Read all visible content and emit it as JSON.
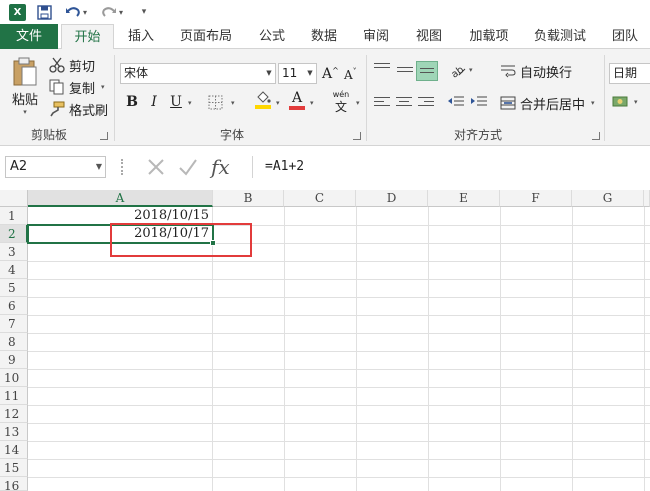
{
  "qat": {
    "logo_text": "X",
    "save_icon": "save-icon",
    "undo_icon": "undo-icon",
    "redo_icon": "redo-icon",
    "customize_icon": "customize-icon"
  },
  "tabs": [
    "文件",
    "开始",
    "插入",
    "页面布局",
    "公式",
    "数据",
    "审阅",
    "视图",
    "加载项",
    "负载测试",
    "团队"
  ],
  "active_tab": "开始",
  "ribbon": {
    "clipboard": {
      "paste_label": "粘贴",
      "cut_label": "剪切",
      "copy_label": "复制",
      "format_painter_label": "格式刷",
      "group_label": "剪贴板"
    },
    "font": {
      "font_name": "宋体",
      "font_size": "11",
      "grow_label": "A",
      "shrink_label": "A",
      "bold_label": "B",
      "italic_label": "I",
      "underline_label": "U",
      "phonetic_label": "wén",
      "font_color_label": "A",
      "group_label": "字体"
    },
    "alignment": {
      "wrap_label": "自动换行",
      "merge_label": "合并后居中",
      "group_label": "对齐方式"
    },
    "number": {
      "format_value": "日期"
    }
  },
  "formula_bar": {
    "name_box": "A2",
    "fx_label": "fx",
    "formula": "=A1+2"
  },
  "grid": {
    "columns": [
      "A",
      "B",
      "C",
      "D",
      "E",
      "F",
      "G"
    ],
    "rows": [
      "1",
      "2",
      "3",
      "4",
      "5",
      "6",
      "7",
      "8",
      "9",
      "10",
      "11",
      "12",
      "13",
      "14",
      "15",
      "16"
    ],
    "cells": {
      "A1": "2018/10/15",
      "A2": "2018/10/17"
    }
  },
  "colors": {
    "accent": "#217346",
    "highlight": "#e23b3b",
    "font_color_swatch": "#e23b3b",
    "fill_color_swatch": "#ffd700"
  }
}
